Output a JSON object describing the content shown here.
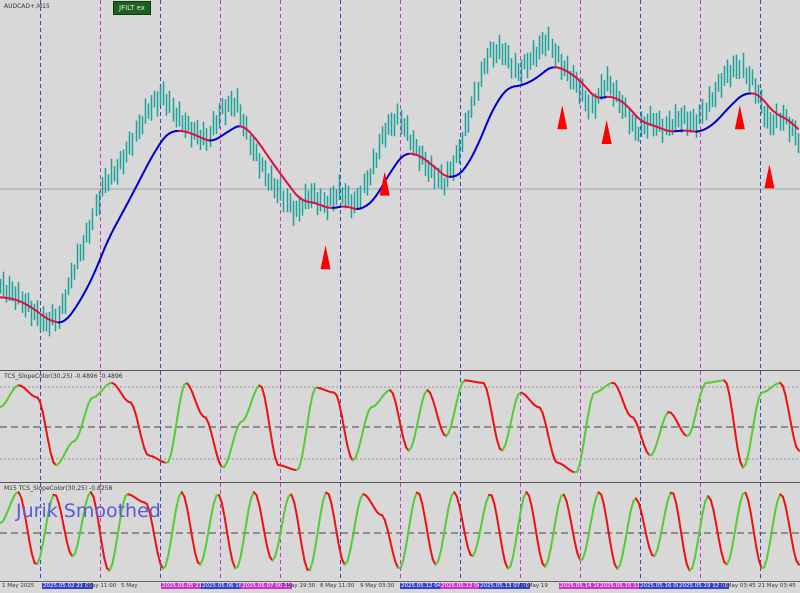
{
  "symbol_label": "AUDCAD+,M15",
  "ea_button": "JFILT ex",
  "indicator1_label": "TCS_SlopeColor(30,25) -0.4896 -0.4896",
  "indicator2_label": "M15 TCS_SlopeColor(30,25) -0.8258",
  "overlay_text": "Jurik Smoothed",
  "colors": {
    "background": "#d8d8d8",
    "candles": "#1aa39a",
    "ma_up": "#0000cc",
    "ma_down": "#dd1144",
    "osc_up": "#55cc33",
    "osc_down": "#ee1111",
    "signal_arrow": "#ff0000",
    "vline_blue": "#3344cc",
    "vline_magenta": "#cc33cc"
  },
  "time_axis": [
    {
      "label": "1 May 2025",
      "highlight": ""
    },
    {
      "label": "2025.05.02 21:00",
      "highlight": "#3344cc"
    },
    {
      "label": "2 May 11:00",
      "highlight": ""
    },
    {
      "label": "5 May",
      "highlight": ""
    },
    {
      "label": "2025.05.05 21:30",
      "highlight": "#cc33cc"
    },
    {
      "label": "2025.05.06 18:30",
      "highlight": "#3344cc"
    },
    {
      "label": "2025.05.07 00:30",
      "highlight": "#cc33cc"
    },
    {
      "label": "7 May 19:30",
      "highlight": ""
    },
    {
      "label": "8 May 11:30",
      "highlight": ""
    },
    {
      "label": "9 May 03:30",
      "highlight": ""
    },
    {
      "label": "2025.05.12 04:15",
      "highlight": "#3344cc"
    },
    {
      "label": "2025.05.12 06:45",
      "highlight": "#cc33cc"
    },
    {
      "label": "2025.05.13 07:30",
      "highlight": "#3344cc"
    },
    {
      "label": "13 May 19",
      "highlight": ""
    },
    {
      "label": "2025.05.14 16:30",
      "highlight": "#cc33cc"
    },
    {
      "label": "2025.05.15 11:15",
      "highlight": "#cc33cc"
    },
    {
      "label": "2025.05.16 08:15",
      "highlight": "#3344cc"
    },
    {
      "label": "2025.05.19 12:00",
      "highlight": "#3344cc"
    },
    {
      "label": "20 May 03:45",
      "highlight": ""
    },
    {
      "label": "21 May 03:45",
      "highlight": ""
    }
  ],
  "chart_data": {
    "type": "line",
    "price": [
      0.3,
      0.28,
      0.24,
      0.2,
      0.22,
      0.35,
      0.45,
      0.58,
      0.62,
      0.7,
      0.78,
      0.82,
      0.76,
      0.72,
      0.7,
      0.78,
      0.8,
      0.68,
      0.6,
      0.55,
      0.5,
      0.55,
      0.52,
      0.56,
      0.52,
      0.6,
      0.72,
      0.76,
      0.68,
      0.62,
      0.58,
      0.66,
      0.8,
      0.93,
      0.94,
      0.88,
      0.92,
      0.97,
      0.9,
      0.85,
      0.78,
      0.86,
      0.8,
      0.72,
      0.75,
      0.73,
      0.76,
      0.74,
      0.8,
      0.87,
      0.9,
      0.85,
      0.74,
      0.76,
      0.7
    ],
    "oscillator_1": [
      0.4,
      0.85,
      0.6,
      -0.8,
      -0.3,
      0.6,
      0.9,
      0.5,
      -0.6,
      -0.75,
      0.9,
      0.2,
      -0.85,
      0.1,
      0.85,
      -0.8,
      -0.9,
      0.8,
      0.7,
      -0.7,
      0.4,
      0.75,
      -0.5,
      0.75,
      -0.2,
      0.95,
      0.9,
      -0.5,
      0.7,
      0.4,
      -0.75,
      -0.95,
      0.7,
      0.9,
      0.2,
      -0.6,
      0.3,
      -0.2,
      0.9,
      0.95,
      -0.85,
      0.7,
      0.9,
      -0.5
    ],
    "oscillator_2": [
      0.2,
      0.95,
      -0.8,
      0.9,
      -0.6,
      0.95,
      -0.95,
      0.9,
      0.7,
      -0.9,
      0.95,
      -0.8,
      0.9,
      -0.9,
      0.95,
      -0.7,
      0.9,
      -0.95,
      0.95,
      -0.8,
      0.9,
      0.4,
      -0.9,
      0.95,
      -0.8,
      0.95,
      -0.6,
      0.9,
      -0.9,
      0.95,
      -0.85,
      0.9,
      -0.7,
      0.95,
      -0.9,
      0.8,
      -0.6,
      0.95,
      -0.95,
      0.85,
      -0.8,
      0.95,
      -0.9,
      0.9,
      -0.8
    ],
    "vertical_markers": [
      "blue",
      "magenta",
      "blue",
      "magenta",
      "magenta",
      "blue",
      "magenta",
      "blue",
      "magenta",
      "magenta",
      "blue",
      "magenta",
      "blue"
    ],
    "sell_signals": [
      22,
      26,
      38,
      41,
      50,
      52
    ]
  }
}
